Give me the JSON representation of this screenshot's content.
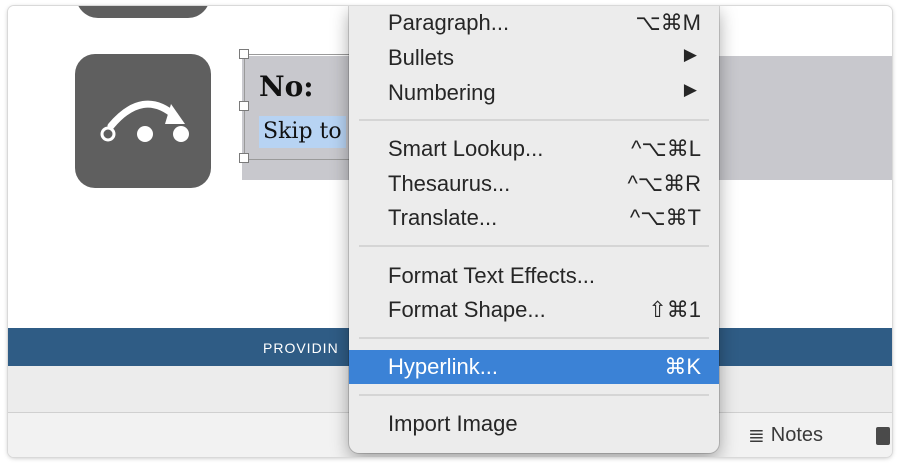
{
  "slide": {
    "heading": "No:",
    "text": "Skip to",
    "banner_text": "PROVIDIN"
  },
  "context_menu": {
    "items": [
      {
        "label": "Paragraph...",
        "shortcut": "⌥⌘M"
      },
      {
        "label": "Bullets",
        "submenu": true
      },
      {
        "label": "Numbering",
        "submenu": true
      },
      {
        "label": "Smart Lookup...",
        "shortcut": "^⌥⌘L"
      },
      {
        "label": "Thesaurus...",
        "shortcut": "^⌥⌘R"
      },
      {
        "label": "Translate...",
        "shortcut": "^⌥⌘T"
      },
      {
        "label": "Format Text Effects..."
      },
      {
        "label": "Format Shape...",
        "shortcut": "⇧⌘1"
      },
      {
        "label": "Hyperlink...",
        "shortcut": "⌘K",
        "highlighted": true
      },
      {
        "label": "Import Image"
      }
    ],
    "submenu_arrow": "▶"
  },
  "status_bar": {
    "notes_label": "Notes",
    "notes_icon": "≣"
  },
  "colors": {
    "menu_highlight": "#3b82d6",
    "banner": "#2f5c85",
    "icon_tile": "#5f5f5f",
    "selection": "#b7d3f3"
  },
  "icons": [
    "skip-arrow-icon",
    "chevron-right-icon",
    "notes-icon",
    "comment-icon"
  ]
}
